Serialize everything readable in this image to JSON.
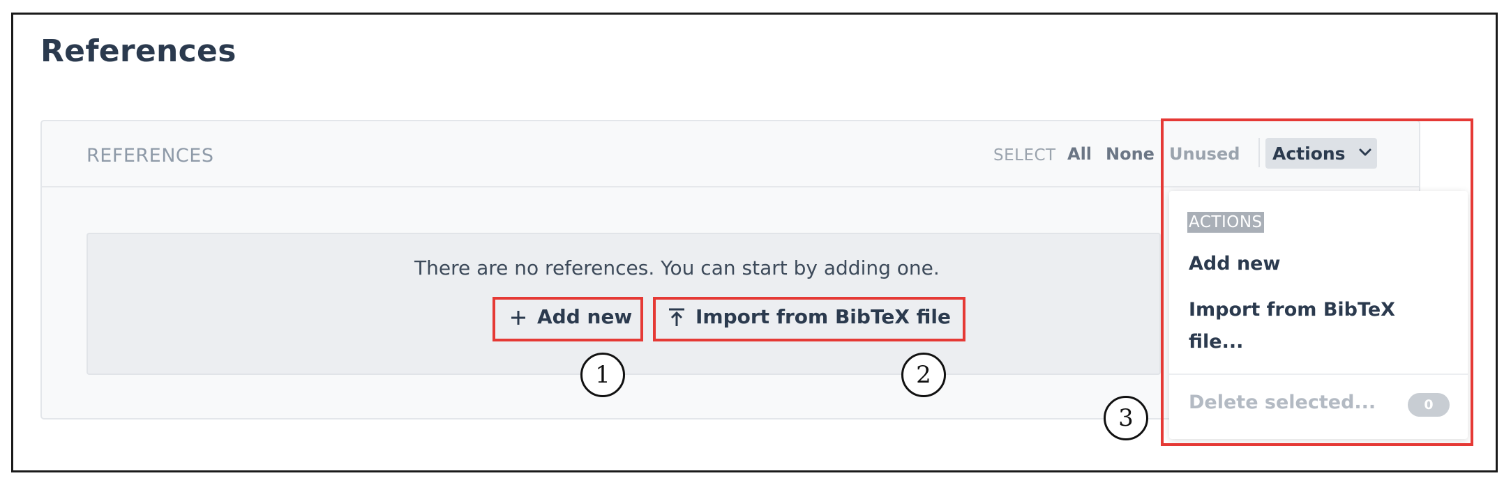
{
  "page": {
    "title": "References"
  },
  "panel": {
    "title": "REFERENCES",
    "select_label": "SELECT",
    "select_options": {
      "all": "All",
      "none": "None",
      "unused": "Unused"
    },
    "actions_label": "Actions"
  },
  "empty_state": {
    "message": "There are no references. You can start by adding one.",
    "add_label": "Add new",
    "import_label": "Import from BibTeX file"
  },
  "dropdown": {
    "header": "ACTIONS",
    "add_label": "Add new",
    "import_label": "Import from BibTeX file...",
    "delete_label": "Delete selected...",
    "selected_count": "0"
  },
  "callouts": {
    "one": "1",
    "two": "2",
    "three": "3"
  },
  "colors": {
    "callout": "#e53935",
    "title": "#2b3a4e",
    "muted": "#9aa3ad"
  },
  "icons": {
    "add": "plus-icon",
    "import": "upload-icon",
    "actions": "chevron-down-icon"
  }
}
